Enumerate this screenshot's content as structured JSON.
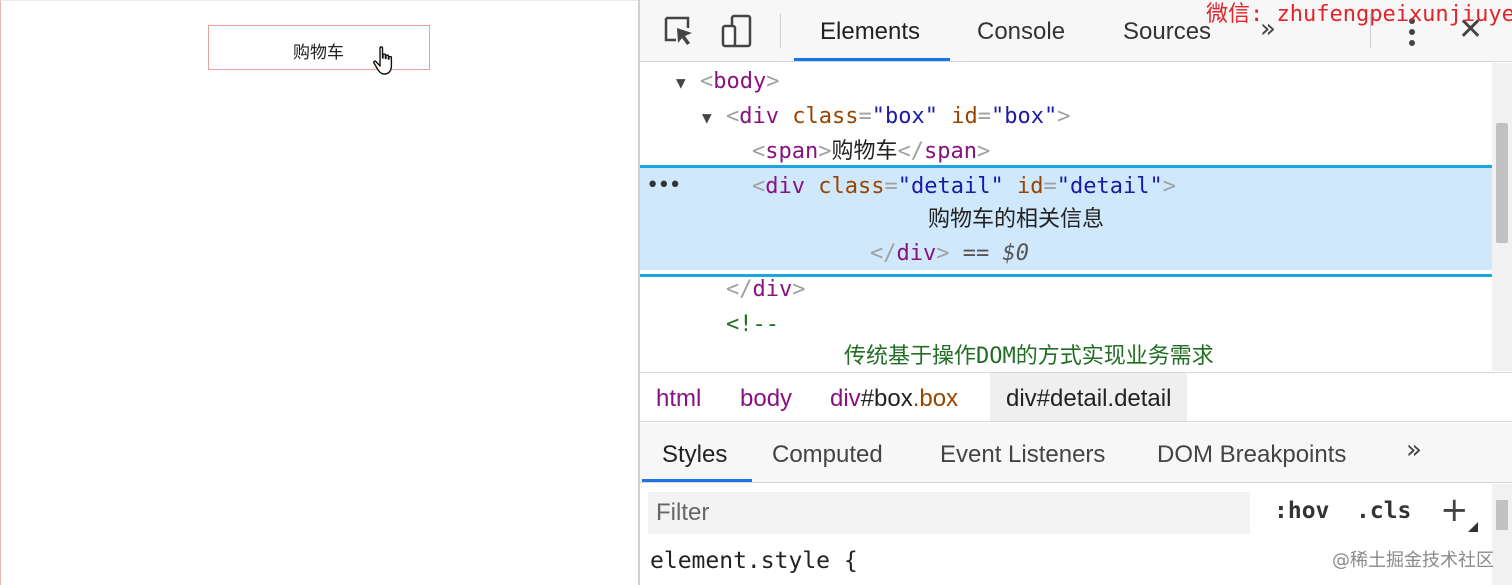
{
  "page": {
    "cart_button_label": "购物车"
  },
  "devtools": {
    "tabs": [
      "Elements",
      "Console",
      "Sources"
    ],
    "active_tab": "Elements",
    "more_tabs_glyph": "»",
    "close_glyph": "✕",
    "watermark_top": "微信: zhufengpeixunjiuye",
    "accent_color": "#1a73e8",
    "dom": {
      "body_tag": "body",
      "box_tag": "div",
      "attr_class": "class",
      "attr_id": "id",
      "box_class": "box",
      "box_id": "box",
      "span_tag": "span",
      "span_text": "购物车",
      "detail_class": "detail",
      "detail_id": "detail",
      "detail_text": "购物车的相关信息",
      "selected_marker": "== $0",
      "ellipsis": "•••",
      "comment_open": "<!--",
      "comment_text": "传统基于操作DOM的方式实现业务需求"
    },
    "breadcrumb": {
      "html": "html",
      "body": "body",
      "box_tag": "div",
      "box_id": "#box",
      "box_cls": ".box",
      "current": "div#detail.detail"
    },
    "styles_tabs": [
      "Styles",
      "Computed",
      "Event Listeners",
      "DOM Breakpoints"
    ],
    "styles_more": "»",
    "filter_placeholder": "Filter",
    "hov_label": ":hov",
    "cls_label": ".cls",
    "plus_label": "+",
    "element_style": "element.style {",
    "watermark_bottom": "@稀土掘金技术社区"
  }
}
